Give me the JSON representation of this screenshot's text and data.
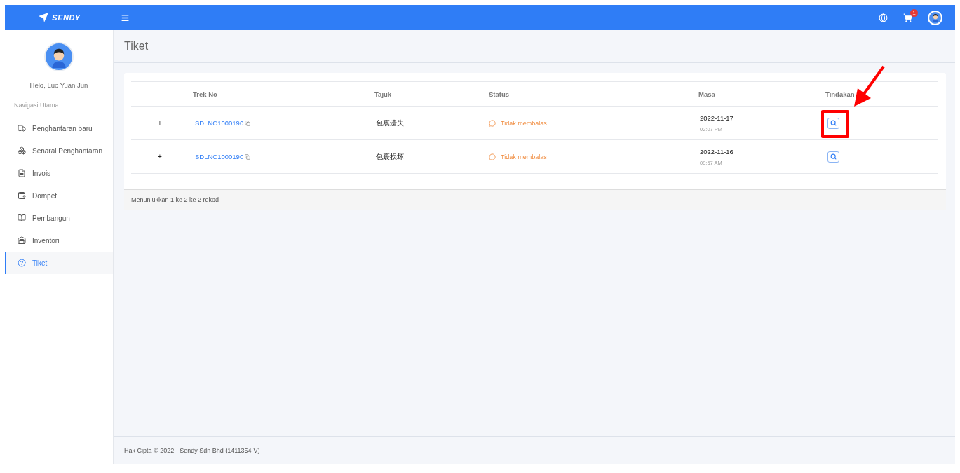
{
  "header": {
    "logo": "SENDY",
    "cart_count": "1"
  },
  "sidebar": {
    "greeting": "Helo, Luo Yuan Jun",
    "section": "Navigasi Utama",
    "items": [
      {
        "label": "Penghantaran baru",
        "selected": false
      },
      {
        "label": "Senarai Penghantaran",
        "selected": false
      },
      {
        "label": "Invois",
        "selected": false
      },
      {
        "label": "Dompet",
        "selected": false
      },
      {
        "label": "Pembangun",
        "selected": false
      },
      {
        "label": "Inventori",
        "selected": false
      },
      {
        "label": "Tiket",
        "selected": true
      }
    ]
  },
  "page": {
    "title": "Tiket"
  },
  "table": {
    "columns": [
      "Trek No",
      "Tajuk",
      "Status",
      "Masa",
      "Tindakan"
    ],
    "rows": [
      {
        "expand": "+",
        "trek_no": "SDLNC1000190",
        "tajuk": "包裹遗失",
        "status": "Tidak membalas",
        "date": "2022-11-17",
        "time": "02:07 PM",
        "highlighted": true
      },
      {
        "expand": "+",
        "trek_no": "SDLNC1000190",
        "tajuk": "包裹损坏",
        "status": "Tidak membalas",
        "date": "2022-11-16",
        "time": "09:57 AM",
        "highlighted": false
      }
    ],
    "summary": "Menunjukkan 1 ke 2 ke 2 rekod"
  },
  "footer": "Hak Cipta © 2022 - Sendy Sdn Bhd (1411354-V)"
}
